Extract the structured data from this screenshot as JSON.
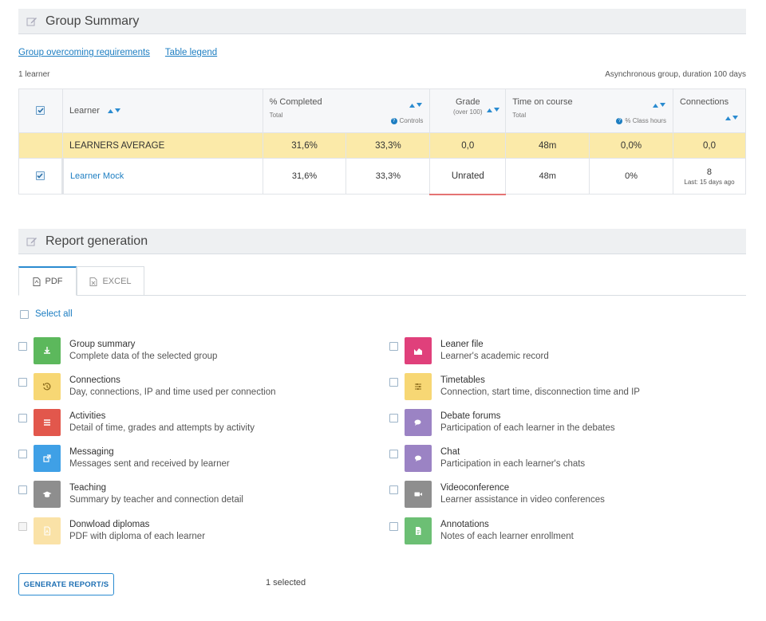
{
  "group_summary": {
    "title": "Group Summary",
    "link_requirements": "Group overcoming requirements",
    "link_legend": "Table legend",
    "learner_count": "1 learner",
    "group_info": "Asynchronous group, duration 100 days"
  },
  "table": {
    "headers": {
      "learner": "Learner",
      "completed": "% Completed",
      "completed_total": "Total",
      "completed_controls": "Controls",
      "grade": "Grade",
      "grade_sub": "(over 100)",
      "time": "Time on course",
      "time_total": "Total",
      "time_class": "% Class hours",
      "connections": "Connections"
    },
    "average": {
      "label": "LEARNERS AVERAGE",
      "completed_total": "31,6%",
      "completed_controls": "33,3%",
      "grade": "0,0",
      "time_total": "48m",
      "time_class": "0,0%",
      "connections": "0,0"
    },
    "learner": {
      "name": "Learner Mock",
      "completed_total": "31,6%",
      "completed_controls": "33,3%",
      "grade": "Unrated",
      "time_total": "48m",
      "time_class": "0%",
      "connections": "8",
      "last": "Last: 15 days ago"
    }
  },
  "report": {
    "title": "Report generation",
    "tabs": [
      {
        "label": "PDF"
      },
      {
        "label": "EXCEL"
      }
    ],
    "select_all": "Select all",
    "items": [
      {
        "title": "Group summary",
        "desc": "Complete data of the selected group",
        "color": "#5cb85c",
        "icon": "download-icon"
      },
      {
        "title": "Leaner file",
        "desc": "Learner's academic record",
        "color": "#e0407b",
        "icon": "area-chart-icon"
      },
      {
        "title": "Connections",
        "desc": "Day, connections, IP and time used per connection",
        "color": "#f7d774",
        "icon": "history-icon"
      },
      {
        "title": "Timetables",
        "desc": "Connection, start time, disconnection time and IP",
        "color": "#f7d774",
        "icon": "sliders-icon"
      },
      {
        "title": "Activities",
        "desc": "Detail of time, grades and attempts by activity",
        "color": "#e2574c",
        "icon": "list-icon"
      },
      {
        "title": "Debate forums",
        "desc": "Participation of each learner in the debates",
        "color": "#9b83c4",
        "icon": "comments-icon"
      },
      {
        "title": "Messaging",
        "desc": "Messages sent and received by learner",
        "color": "#3fa0e6",
        "icon": "external-link-icon"
      },
      {
        "title": "Chat",
        "desc": "Participation in each learner's chats",
        "color": "#9b83c4",
        "icon": "chat-icon"
      },
      {
        "title": "Teaching",
        "desc": "Summary by teacher and connection detail",
        "color": "#8e8e8e",
        "icon": "graduation-cap-icon"
      },
      {
        "title": "Videoconference",
        "desc": "Learner assistance in video conferences",
        "color": "#8e8e8e",
        "icon": "video-camera-icon"
      },
      {
        "title": "Donwload diplomas",
        "desc": "PDF with diploma of each learner",
        "color": "#f9d98a",
        "icon": "pdf-file-icon"
      },
      {
        "title": "Annotations",
        "desc": "Notes of each learner enrollment",
        "color": "#6cbf74",
        "icon": "file-text-icon"
      }
    ],
    "generate_label": "GENERATE REPORT/S",
    "selected_count": "1 selected"
  }
}
